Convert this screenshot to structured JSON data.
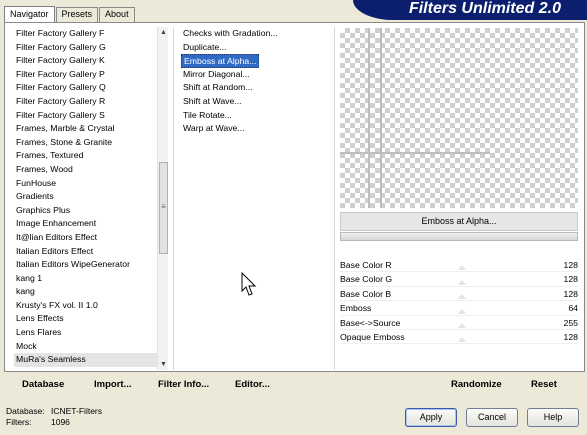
{
  "tabs": [
    "Navigator",
    "Presets",
    "About"
  ],
  "app_title": "Filters Unlimited 2.0",
  "filters": [
    "Filter Factory Gallery F",
    "Filter Factory Gallery G",
    "Filter Factory Gallery K",
    "Filter Factory Gallery P",
    "Filter Factory Gallery Q",
    "Filter Factory Gallery R",
    "Filter Factory Gallery S",
    "Frames, Marble & Crystal",
    "Frames, Stone & Granite",
    "Frames, Textured",
    "Frames, Wood",
    "FunHouse",
    "Gradients",
    "Graphics Plus",
    "Image Enhancement",
    "It@lian Editors Effect",
    "Italian Editors Effect",
    "Italian Editors WipeGenerator",
    "kang 1",
    "kang",
    "Krusty's FX vol. II 1.0",
    "Lens Effects",
    "Lens Flares",
    "Mock",
    "MuRa's Seamless"
  ],
  "selected_filter": "MuRa's Seamless",
  "effects": [
    "Checks with Gradation...",
    "Duplicate...",
    "Emboss at Alpha...",
    "Mirror Diagonal...",
    "Shift at Random...",
    "Shift at Wave...",
    "Tile Rotate...",
    "Warp at Wave..."
  ],
  "selected_effect": "Emboss at Alpha...",
  "effect_name": "Emboss at Alpha...",
  "params": [
    {
      "name": "Base Color R",
      "value": "128"
    },
    {
      "name": "Base Color G",
      "value": "128"
    },
    {
      "name": "Base Color B",
      "value": "128"
    },
    {
      "name": "Emboss",
      "value": "64"
    },
    {
      "name": "Base<->Source",
      "value": "255"
    },
    {
      "name": "Opaque Emboss",
      "value": "128"
    }
  ],
  "bottom_buttons": {
    "database": "Database",
    "import": "Import...",
    "filter_info": "Filter Info...",
    "editor": "Editor...",
    "randomize": "Randomize",
    "reset": "Reset"
  },
  "status": {
    "database_label": "Database:",
    "database_value": "ICNET-Filters",
    "filters_label": "Filters:",
    "filters_value": "1096"
  },
  "dialog_buttons": {
    "apply": "Apply",
    "cancel": "Cancel",
    "help": "Help"
  },
  "colors": {
    "banner": "#0b1f6e",
    "selection": "#316ac5",
    "dialog_bg": "#ece9d8"
  }
}
